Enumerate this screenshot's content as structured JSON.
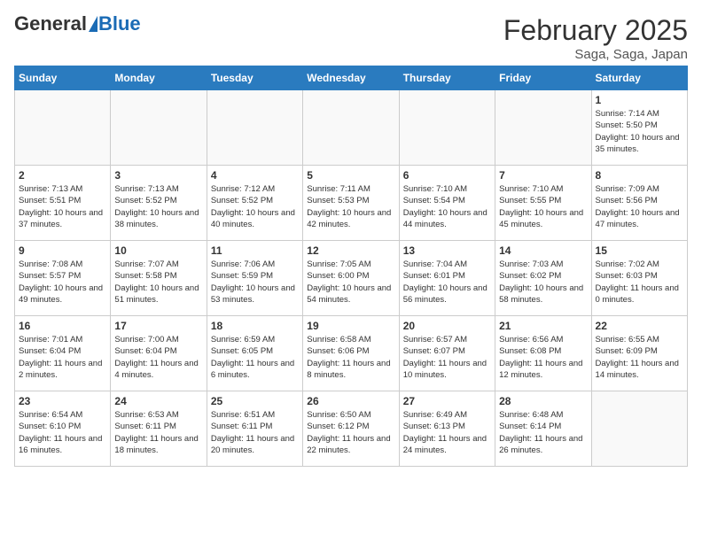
{
  "header": {
    "logo_general": "General",
    "logo_blue": "Blue",
    "month_title": "February 2025",
    "location": "Saga, Saga, Japan"
  },
  "columns": [
    "Sunday",
    "Monday",
    "Tuesday",
    "Wednesday",
    "Thursday",
    "Friday",
    "Saturday"
  ],
  "weeks": [
    {
      "days": [
        {
          "num": "",
          "info": ""
        },
        {
          "num": "",
          "info": ""
        },
        {
          "num": "",
          "info": ""
        },
        {
          "num": "",
          "info": ""
        },
        {
          "num": "",
          "info": ""
        },
        {
          "num": "",
          "info": ""
        },
        {
          "num": "1",
          "info": "Sunrise: 7:14 AM\nSunset: 5:50 PM\nDaylight: 10 hours\nand 35 minutes."
        }
      ]
    },
    {
      "days": [
        {
          "num": "2",
          "info": "Sunrise: 7:13 AM\nSunset: 5:51 PM\nDaylight: 10 hours\nand 37 minutes."
        },
        {
          "num": "3",
          "info": "Sunrise: 7:13 AM\nSunset: 5:52 PM\nDaylight: 10 hours\nand 38 minutes."
        },
        {
          "num": "4",
          "info": "Sunrise: 7:12 AM\nSunset: 5:52 PM\nDaylight: 10 hours\nand 40 minutes."
        },
        {
          "num": "5",
          "info": "Sunrise: 7:11 AM\nSunset: 5:53 PM\nDaylight: 10 hours\nand 42 minutes."
        },
        {
          "num": "6",
          "info": "Sunrise: 7:10 AM\nSunset: 5:54 PM\nDaylight: 10 hours\nand 44 minutes."
        },
        {
          "num": "7",
          "info": "Sunrise: 7:10 AM\nSunset: 5:55 PM\nDaylight: 10 hours\nand 45 minutes."
        },
        {
          "num": "8",
          "info": "Sunrise: 7:09 AM\nSunset: 5:56 PM\nDaylight: 10 hours\nand 47 minutes."
        }
      ]
    },
    {
      "days": [
        {
          "num": "9",
          "info": "Sunrise: 7:08 AM\nSunset: 5:57 PM\nDaylight: 10 hours\nand 49 minutes."
        },
        {
          "num": "10",
          "info": "Sunrise: 7:07 AM\nSunset: 5:58 PM\nDaylight: 10 hours\nand 51 minutes."
        },
        {
          "num": "11",
          "info": "Sunrise: 7:06 AM\nSunset: 5:59 PM\nDaylight: 10 hours\nand 53 minutes."
        },
        {
          "num": "12",
          "info": "Sunrise: 7:05 AM\nSunset: 6:00 PM\nDaylight: 10 hours\nand 54 minutes."
        },
        {
          "num": "13",
          "info": "Sunrise: 7:04 AM\nSunset: 6:01 PM\nDaylight: 10 hours\nand 56 minutes."
        },
        {
          "num": "14",
          "info": "Sunrise: 7:03 AM\nSunset: 6:02 PM\nDaylight: 10 hours\nand 58 minutes."
        },
        {
          "num": "15",
          "info": "Sunrise: 7:02 AM\nSunset: 6:03 PM\nDaylight: 11 hours\nand 0 minutes."
        }
      ]
    },
    {
      "days": [
        {
          "num": "16",
          "info": "Sunrise: 7:01 AM\nSunset: 6:04 PM\nDaylight: 11 hours\nand 2 minutes."
        },
        {
          "num": "17",
          "info": "Sunrise: 7:00 AM\nSunset: 6:04 PM\nDaylight: 11 hours\nand 4 minutes."
        },
        {
          "num": "18",
          "info": "Sunrise: 6:59 AM\nSunset: 6:05 PM\nDaylight: 11 hours\nand 6 minutes."
        },
        {
          "num": "19",
          "info": "Sunrise: 6:58 AM\nSunset: 6:06 PM\nDaylight: 11 hours\nand 8 minutes."
        },
        {
          "num": "20",
          "info": "Sunrise: 6:57 AM\nSunset: 6:07 PM\nDaylight: 11 hours\nand 10 minutes."
        },
        {
          "num": "21",
          "info": "Sunrise: 6:56 AM\nSunset: 6:08 PM\nDaylight: 11 hours\nand 12 minutes."
        },
        {
          "num": "22",
          "info": "Sunrise: 6:55 AM\nSunset: 6:09 PM\nDaylight: 11 hours\nand 14 minutes."
        }
      ]
    },
    {
      "days": [
        {
          "num": "23",
          "info": "Sunrise: 6:54 AM\nSunset: 6:10 PM\nDaylight: 11 hours\nand 16 minutes."
        },
        {
          "num": "24",
          "info": "Sunrise: 6:53 AM\nSunset: 6:11 PM\nDaylight: 11 hours\nand 18 minutes."
        },
        {
          "num": "25",
          "info": "Sunrise: 6:51 AM\nSunset: 6:11 PM\nDaylight: 11 hours\nand 20 minutes."
        },
        {
          "num": "26",
          "info": "Sunrise: 6:50 AM\nSunset: 6:12 PM\nDaylight: 11 hours\nand 22 minutes."
        },
        {
          "num": "27",
          "info": "Sunrise: 6:49 AM\nSunset: 6:13 PM\nDaylight: 11 hours\nand 24 minutes."
        },
        {
          "num": "28",
          "info": "Sunrise: 6:48 AM\nSunset: 6:14 PM\nDaylight: 11 hours\nand 26 minutes."
        },
        {
          "num": "",
          "info": ""
        }
      ]
    }
  ]
}
